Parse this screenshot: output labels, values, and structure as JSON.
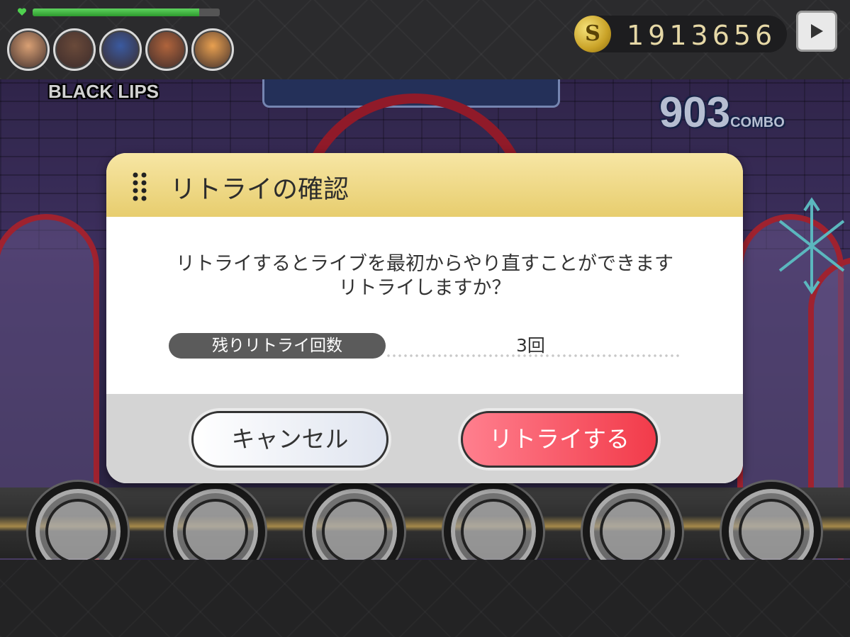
{
  "hud": {
    "life_fraction": 0.89,
    "coins": "1913656",
    "coin_symbol": "S",
    "song_title": "BLACK LIPS",
    "combo_count": "903",
    "combo_label": "COMBO",
    "icons": [
      "heart-icon",
      "coin-icon",
      "play-icon"
    ],
    "avatar_colors": [
      "#d9a074",
      "#6a4a3a",
      "#3a5aa0",
      "#b0643c",
      "#e8a050"
    ]
  },
  "dialog": {
    "title": "リトライの確認",
    "message_line1": "リトライするとライブを最初からやり直すことができます",
    "message_line2": "リトライしますか？",
    "retry_label": "残りリトライ回数",
    "retry_value": "3回",
    "cancel_label": "キャンセル",
    "retry_button_label": "リトライする"
  },
  "colors": {
    "header_gold": "#e7cd6e",
    "retry_red": "#f23b4a",
    "hp_green": "#3fb83f"
  }
}
